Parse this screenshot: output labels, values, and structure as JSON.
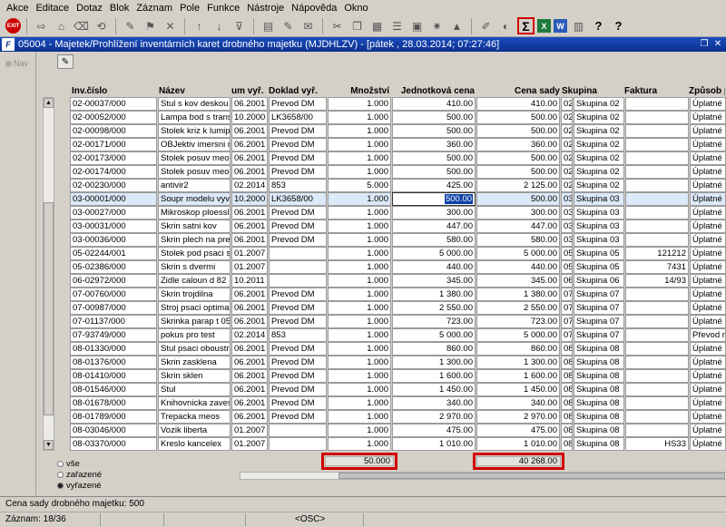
{
  "menu": [
    "Akce",
    "Editace",
    "Dotaz",
    "Blok",
    "Záznam",
    "Pole",
    "Funkce",
    "Nástroje",
    "Nápověda",
    "Okno"
  ],
  "window_title": "05004 - Majetek/Prohlížení inventárních karet drobného majetku (MJDHLZV) - [pátek   , 28.03.2014; 07:27:46]",
  "left_nav_label": "Nav",
  "columns": {
    "inv": "Inv.číslo",
    "nazev": "Název",
    "datum": "um vyř.",
    "doklad": "Doklad vyř.",
    "mnozstvi": "Množství",
    "jedn_cena": "Jednotková cena",
    "cena_sady": "Cena sady",
    "skupina": "Skupina",
    "faktura": "Faktura",
    "zpusob": "Způsob p"
  },
  "rows": [
    {
      "inv": "02-00037/000",
      "nazev": "Stul s kov deskou",
      "datum": "06.2001",
      "doklad": "Prevod DM",
      "mnozstvi": "1.000",
      "jedn_cena": "410.00",
      "cena_sady": "410.00",
      "sk": "02",
      "skupina": "Skupina 02",
      "faktura": "",
      "zpusob": "Úplatné n"
    },
    {
      "inv": "02-00052/000",
      "nazev": "Lampa bod s transf",
      "datum": "10.2000",
      "doklad": "LK3658/00",
      "mnozstvi": "1.000",
      "jedn_cena": "500.00",
      "cena_sady": "500.00",
      "sk": "02",
      "skupina": "Skupina 02",
      "faktura": "",
      "zpusob": "Úplatné n"
    },
    {
      "inv": "02-00098/000",
      "nazev": "Stolek kriz k lumipan",
      "datum": "06.2001",
      "doklad": "Prevod DM",
      "mnozstvi": "1.000",
      "jedn_cena": "500.00",
      "cena_sady": "500.00",
      "sk": "02",
      "skupina": "Skupina 02",
      "faktura": "",
      "zpusob": "Úplatné n"
    },
    {
      "inv": "02-00171/000",
      "nazev": "OBJektiv imersni me",
      "datum": "06.2001",
      "doklad": "Prevod DM",
      "mnozstvi": "1.000",
      "jedn_cena": "360.00",
      "cena_sady": "360.00",
      "sk": "02",
      "skupina": "Skupina 02",
      "faktura": "",
      "zpusob": "Úplatné n"
    },
    {
      "inv": "02-00173/000",
      "nazev": "Stolek posuv meopt",
      "datum": "06.2001",
      "doklad": "Prevod DM",
      "mnozstvi": "1.000",
      "jedn_cena": "500.00",
      "cena_sady": "500.00",
      "sk": "02",
      "skupina": "Skupina 02",
      "faktura": "",
      "zpusob": "Úplatné n"
    },
    {
      "inv": "02-00174/000",
      "nazev": "Stolek posuv meopt",
      "datum": "06.2001",
      "doklad": "Prevod DM",
      "mnozstvi": "1.000",
      "jedn_cena": "500.00",
      "cena_sady": "500.00",
      "sk": "02",
      "skupina": "Skupina 02",
      "faktura": "",
      "zpusob": "Úplatné n"
    },
    {
      "inv": "02-00230/000",
      "nazev": "antivir2",
      "datum": "02.2014",
      "doklad": "853",
      "mnozstvi": "5.000",
      "jedn_cena": "425.00",
      "cena_sady": "2 125.00",
      "sk": "02",
      "skupina": "Skupina 02",
      "faktura": "",
      "zpusob": "Úplatné n"
    },
    {
      "inv": "03-00001/000",
      "nazev": "Soupr modelu vyvoj",
      "datum": "10.2000",
      "doklad": "LK3658/00",
      "mnozstvi": "1.000",
      "jedn_cena": "500.00",
      "cena_sady": "500.00",
      "sk": "03",
      "skupina": "Skupina 03",
      "faktura": "",
      "zpusob": "Úplatné n",
      "selected": true
    },
    {
      "inv": "03-00027/000",
      "nazev": "Mikroskop ploessl st",
      "datum": "06.2001",
      "doklad": "Prevod DM",
      "mnozstvi": "1.000",
      "jedn_cena": "300.00",
      "cena_sady": "300.00",
      "sk": "03",
      "skupina": "Skupina 03",
      "faktura": "",
      "zpusob": "Úplatné n"
    },
    {
      "inv": "03-00031/000",
      "nazev": "Skrin satni kov",
      "datum": "06.2001",
      "doklad": "Prevod DM",
      "mnozstvi": "1.000",
      "jedn_cena": "447.00",
      "cena_sady": "447.00",
      "sk": "03",
      "skupina": "Skupina 03",
      "faktura": "",
      "zpusob": "Úplatné n"
    },
    {
      "inv": "03-00036/000",
      "nazev": "Skrin plech na prepa",
      "datum": "06.2001",
      "doklad": "Prevod DM",
      "mnozstvi": "1.000",
      "jedn_cena": "580.00",
      "cena_sady": "580.00",
      "sk": "03",
      "skupina": "Skupina 03",
      "faktura": "",
      "zpusob": "Úplatné n"
    },
    {
      "inv": "05-02244/001",
      "nazev": "Stolek pod psaci str",
      "datum": "01.2007",
      "doklad": "",
      "mnozstvi": "1.000",
      "jedn_cena": "5 000.00",
      "cena_sady": "5 000.00",
      "sk": "05",
      "skupina": "Skupina 05",
      "faktura": "121212",
      "zpusob": "Úplatné n"
    },
    {
      "inv": "05-02386/000",
      "nazev": "Skrin s dvermi",
      "datum": "01.2007",
      "doklad": "",
      "mnozstvi": "1.000",
      "jedn_cena": "440.00",
      "cena_sady": "440.00",
      "sk": "05",
      "skupina": "Skupina 05",
      "faktura": "7431",
      "zpusob": "Úplatné n"
    },
    {
      "inv": "06-02972/000",
      "nazev": "Zidle caloun d 82",
      "datum": "10.2011",
      "doklad": "",
      "mnozstvi": "1.000",
      "jedn_cena": "345.00",
      "cena_sady": "345.00",
      "sk": "06",
      "skupina": "Skupina 06",
      "faktura": "14/93",
      "zpusob": "Úplatné n"
    },
    {
      "inv": "07-00760/000",
      "nazev": "Skrin trojdilna",
      "datum": "06.2001",
      "doklad": "Prevod DM",
      "mnozstvi": "1.000",
      "jedn_cena": "1 380.00",
      "cena_sady": "1 380.00",
      "sk": "07",
      "skupina": "Skupina 07",
      "faktura": "",
      "zpusob": "Úplatné n"
    },
    {
      "inv": "07-00987/000",
      "nazev": "Stroj psaci optima",
      "datum": "06.2001",
      "doklad": "Prevod DM",
      "mnozstvi": "1.000",
      "jedn_cena": "2 550.00",
      "cena_sady": "2 550.00",
      "sk": "07",
      "skupina": "Skupina 07",
      "faktura": "",
      "zpusob": "Úplatné n"
    },
    {
      "inv": "07-01137/000",
      "nazev": "Skrinka parap t 05",
      "datum": "06.2001",
      "doklad": "Prevod DM",
      "mnozstvi": "1.000",
      "jedn_cena": "723.00",
      "cena_sady": "723.00",
      "sk": "07",
      "skupina": "Skupina 07",
      "faktura": "",
      "zpusob": "Úplatné n"
    },
    {
      "inv": "07-93749/000",
      "nazev": "pokus pro test",
      "datum": "02.2014",
      "doklad": "853",
      "mnozstvi": "1.000",
      "jedn_cena": "5 000.00",
      "cena_sady": "5 000.00",
      "sk": "07",
      "skupina": "Skupina 07",
      "faktura": "",
      "zpusob": "Převod m"
    },
    {
      "inv": "08-01330/000",
      "nazev": "Stul psaci oboustr",
      "datum": "06.2001",
      "doklad": "Prevod DM",
      "mnozstvi": "1.000",
      "jedn_cena": "860.00",
      "cena_sady": "860.00",
      "sk": "08",
      "skupina": "Skupina 08",
      "faktura": "",
      "zpusob": "Úplatné n"
    },
    {
      "inv": "08-01376/000",
      "nazev": "Skrin zasklena",
      "datum": "06.2001",
      "doklad": "Prevod DM",
      "mnozstvi": "1.000",
      "jedn_cena": "1 300.00",
      "cena_sady": "1 300.00",
      "sk": "08",
      "skupina": "Skupina 08",
      "faktura": "",
      "zpusob": "Úplatné n"
    },
    {
      "inv": "08-01410/000",
      "nazev": "Skrin sklen",
      "datum": "06.2001",
      "doklad": "Prevod DM",
      "mnozstvi": "1.000",
      "jedn_cena": "1 600.00",
      "cena_sady": "1 600.00",
      "sk": "08",
      "skupina": "Skupina 08",
      "faktura": "",
      "zpusob": "Úplatné n"
    },
    {
      "inv": "08-01546/000",
      "nazev": "Stul",
      "datum": "06.2001",
      "doklad": "Prevod DM",
      "mnozstvi": "1.000",
      "jedn_cena": "1 450.00",
      "cena_sady": "1 450.00",
      "sk": "08",
      "skupina": "Skupina 08",
      "faktura": "",
      "zpusob": "Úplatné n"
    },
    {
      "inv": "08-01678/000",
      "nazev": "Knihovnicka zaves",
      "datum": "06.2001",
      "doklad": "Prevod DM",
      "mnozstvi": "1.000",
      "jedn_cena": "340.00",
      "cena_sady": "340.00",
      "sk": "08",
      "skupina": "Skupina 08",
      "faktura": "",
      "zpusob": "Úplatné n"
    },
    {
      "inv": "08-01789/000",
      "nazev": "Trepacka meos",
      "datum": "06.2001",
      "doklad": "Prevod DM",
      "mnozstvi": "1.000",
      "jedn_cena": "2 970.00",
      "cena_sady": "2 970.00",
      "sk": "08",
      "skupina": "Skupina 08",
      "faktura": "",
      "zpusob": "Úplatné n"
    },
    {
      "inv": "08-03046/000",
      "nazev": "Vozik liberta",
      "datum": "01.2007",
      "doklad": "",
      "mnozstvi": "1.000",
      "jedn_cena": "475.00",
      "cena_sady": "475.00",
      "sk": "08",
      "skupina": "Skupina 08",
      "faktura": "",
      "zpusob": "Úplatné n"
    },
    {
      "inv": "08-03370/000",
      "nazev": "Kreslo kancelex",
      "datum": "01.2007",
      "doklad": "",
      "mnozstvi": "1.000",
      "jedn_cena": "1 010.00",
      "cena_sady": "1 010.00",
      "sk": "08",
      "skupina": "Skupina 08",
      "faktura": "HS33",
      "zpusob": "Úplatné n"
    }
  ],
  "filter": {
    "options": [
      "vše",
      "zařazené",
      "vyřazené"
    ],
    "selected": "vyřazené"
  },
  "totals": {
    "mnozstvi": "50.000",
    "cena_sady": "40 268.00"
  },
  "status": {
    "message": "Cena sady drobného majetku: 500",
    "record": "Záznam: 18/36",
    "mode": "<OSC>"
  },
  "colors": {
    "highlight_border": "#d00000",
    "title_bar": "#0a2f8f",
    "selected_row": "#dce9f8"
  }
}
